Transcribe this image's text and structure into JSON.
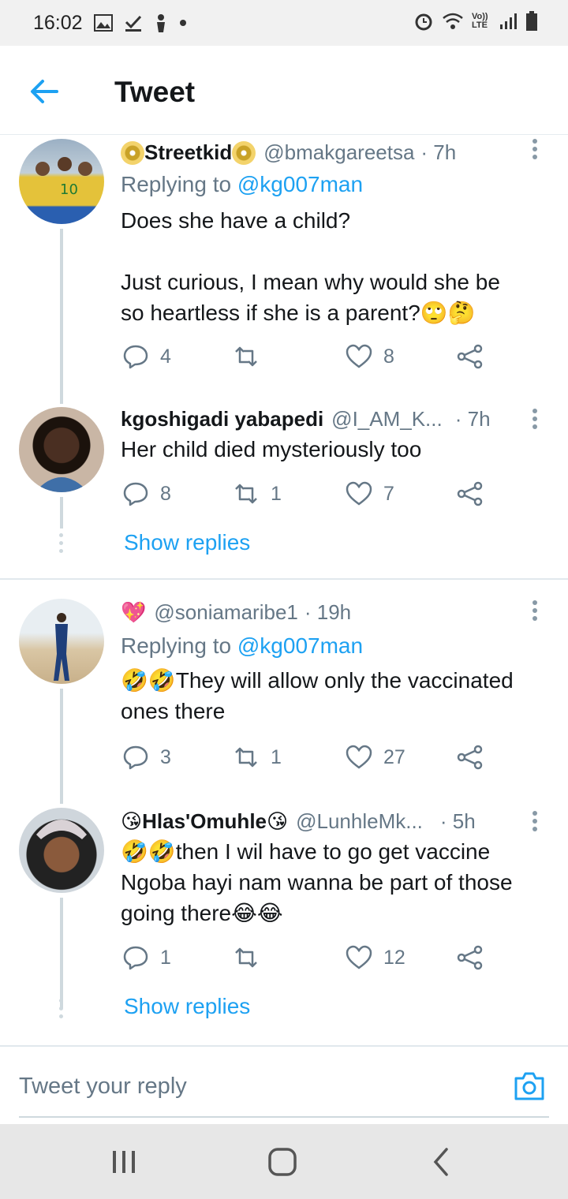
{
  "status_bar": {
    "time": "16:02",
    "left_icons": [
      "gallery-icon",
      "check-icon",
      "person-icon",
      "dot-icon"
    ],
    "right_icons": [
      "alarm-icon",
      "wifi-icon",
      "volte-icon",
      "signal-icon",
      "battery-icon"
    ],
    "volte_label": "Vo)) LTE"
  },
  "header": {
    "title": "Tweet"
  },
  "tweets": [
    {
      "display_name": "Streetkid",
      "handle": "@bmakgareetsa",
      "time": "· 7h",
      "replying_prefix": "Replying to ",
      "replying_to": "@kg007man",
      "text_line1": "Does she have a child?",
      "text_line2": "Just curious, I mean why would she be",
      "text_line3": "so heartless if she is a parent?🙄🤔",
      "replies": "4",
      "retweets": "",
      "likes": "8"
    },
    {
      "display_name": "kgoshigadi yabapedi",
      "handle": "@I_AM_K...",
      "time": "· 7h",
      "text_line1": "Her child died mysteriously too",
      "replies": "8",
      "retweets": "1",
      "likes": "7",
      "show_replies": "Show replies"
    },
    {
      "display_name": "💖",
      "handle": "@soniamaribe1",
      "time": "· 19h",
      "replying_prefix": "Replying to ",
      "replying_to": "@kg007man",
      "text_line1": "🤣🤣They will allow only the vaccinated",
      "text_line2": "ones there",
      "replies": "3",
      "retweets": "1",
      "likes": "27"
    },
    {
      "display_name": "😘Hlas'Omuhle😘",
      "handle": "@LunhleMk...",
      "time": "· 5h",
      "text_line1": "🤣🤣then I wil have to go  get vaccine",
      "text_line2": "Ngoba hayi nam wanna be part of those",
      "text_line3": "going there😂😂",
      "replies": "1",
      "retweets": "",
      "likes": "12",
      "show_replies": "Show replies"
    }
  ],
  "composer": {
    "placeholder": "Tweet your reply"
  },
  "nav_bar": {
    "buttons": [
      "recent-apps",
      "home",
      "back"
    ]
  },
  "colors": {
    "accent": "#1da1f2",
    "muted": "#657786",
    "text": "#14171a"
  }
}
